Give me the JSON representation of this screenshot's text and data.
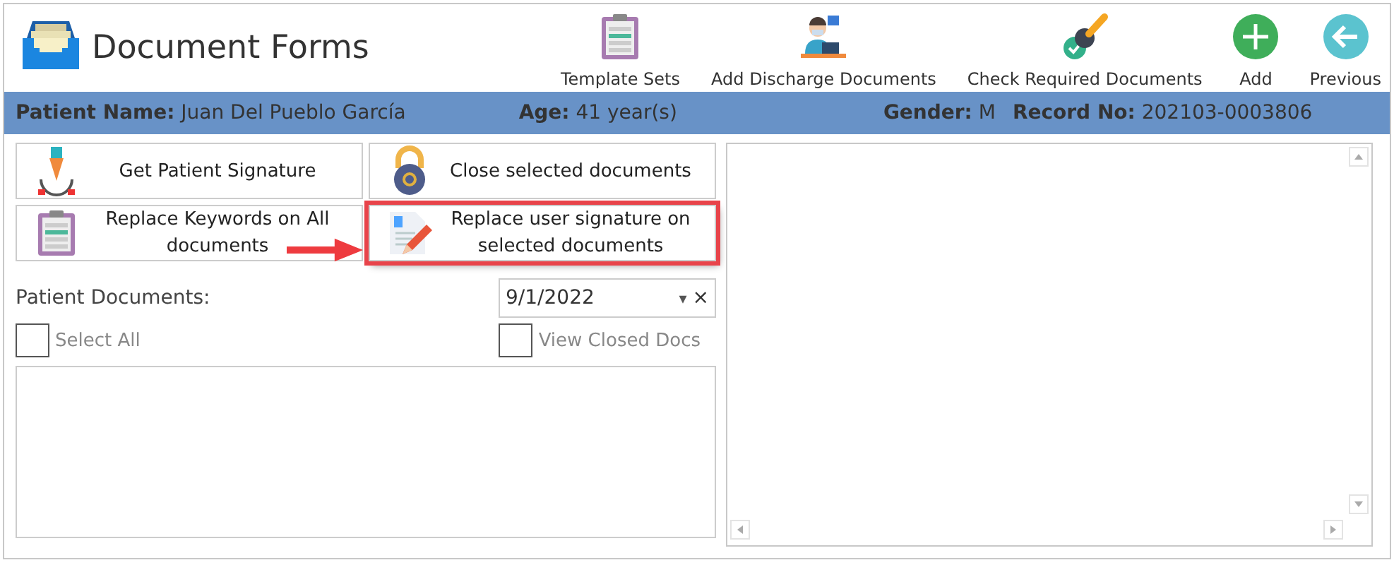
{
  "window": {
    "title": "Document Forms"
  },
  "toolbar": [
    {
      "kind": "clipboard",
      "label": "Template Sets"
    },
    {
      "kind": "nurse",
      "label": "Add Discharge Documents"
    },
    {
      "kind": "stamp",
      "label": "Check Required Documents"
    },
    {
      "kind": "add",
      "label": "Add"
    },
    {
      "kind": "back",
      "label": "Previous"
    }
  ],
  "patient": {
    "fields": [
      {
        "label": "Patient Name:",
        "value": "Juan Del Pueblo García"
      },
      {
        "label": "Age:",
        "value": "41 year(s)"
      },
      {
        "label": "Gender:",
        "value": "M"
      },
      {
        "label": "Record No:",
        "value": "202103-0003806"
      }
    ]
  },
  "actions": [
    {
      "kind": "pen",
      "label": "Get Patient Signature",
      "highlighted": false
    },
    {
      "kind": "lock",
      "label": "Close selected documents",
      "highlighted": false
    },
    {
      "kind": "clipboard",
      "label": "Replace Keywords on All documents",
      "highlighted": false
    },
    {
      "kind": "edit",
      "label": "Replace user signature on selected documents",
      "highlighted": true
    }
  ],
  "documents": {
    "label": "Patient Documents:",
    "date": "9/1/2022",
    "dropdown": "▾",
    "clear": "×",
    "checkboxes": [
      {
        "label": "Select All",
        "checked": false
      },
      {
        "label": "View Closed Docs",
        "checked": false
      }
    ]
  }
}
